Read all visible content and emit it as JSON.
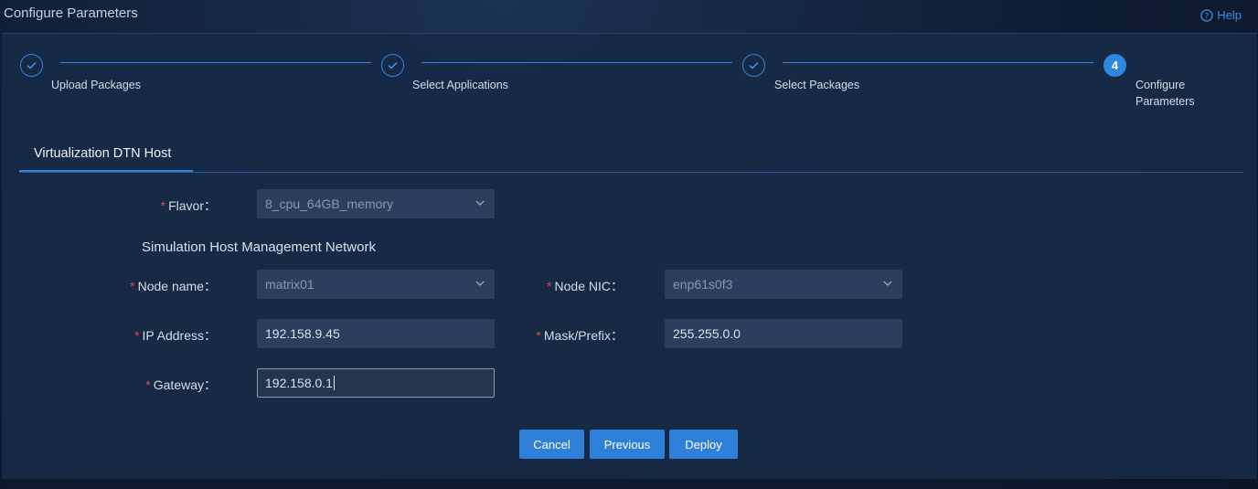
{
  "header": {
    "title": "Configure Parameters",
    "help_label": "Help"
  },
  "stepper": {
    "steps": [
      {
        "label": "Upload Packages",
        "status": "done"
      },
      {
        "label": "Select Applications",
        "status": "done"
      },
      {
        "label": "Select Packages",
        "status": "done"
      },
      {
        "number": "4",
        "label_line1": "Configure",
        "label_line2": "Parameters",
        "status": "active"
      }
    ]
  },
  "tabs": [
    {
      "label": "Virtualization DTN Host",
      "active": true
    }
  ],
  "form": {
    "required_mark": "*",
    "flavor": {
      "label": "Flavor：",
      "value": "8_cpu_64GB_memory"
    },
    "section_title": "Simulation Host Management Network",
    "node_name": {
      "label": "Node name：",
      "value": "matrix01"
    },
    "node_nic": {
      "label": "Node NIC：",
      "value": "enp61s0f3"
    },
    "ip_address": {
      "label": "IP Address：",
      "value": "192.158.9.45"
    },
    "mask_prefix": {
      "label": "Mask/Prefix：",
      "value": "255.255.0.0"
    },
    "gateway": {
      "label": "Gateway：",
      "value": "192.158.0.1"
    }
  },
  "buttons": {
    "cancel": "Cancel",
    "previous": "Previous",
    "deploy": "Deploy"
  },
  "colors": {
    "accent": "#2f86e0",
    "required": "#e0465a",
    "panel": "#172a46"
  }
}
